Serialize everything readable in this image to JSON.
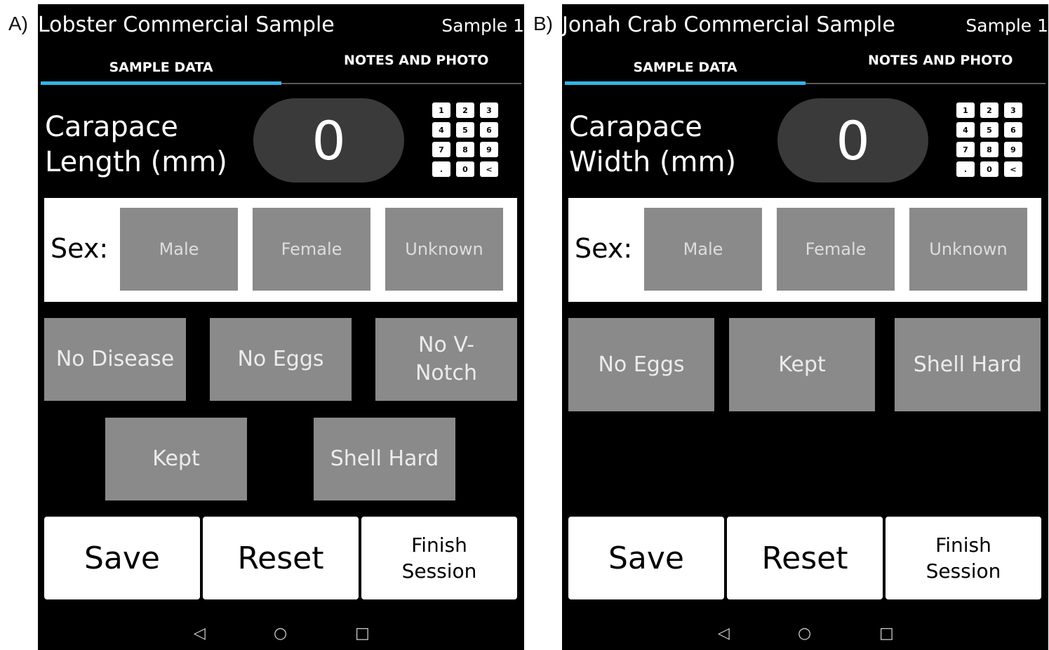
{
  "panels": [
    {
      "label": "A)",
      "title": "Lobster Commercial Sample",
      "sample": "Sample 1",
      "tabs": [
        "SAMPLE DATA",
        "NOTES AND PHOTO"
      ],
      "measure_label": "Carapace Length (mm)",
      "value": "0",
      "keypad": [
        "1",
        "2",
        "3",
        "4",
        "5",
        "6",
        "7",
        "8",
        "9",
        ".",
        "0",
        "<"
      ],
      "sex_label": "Sex:",
      "sex_options": [
        "Male",
        "Female",
        "Unknown"
      ],
      "toggles": [
        "No Disease",
        "No Eggs",
        "No V-Notch",
        "Kept",
        "Shell Hard"
      ],
      "actions": [
        "Save",
        "Reset",
        "Finish Session"
      ],
      "nav": [
        "◁",
        "○",
        "□"
      ]
    },
    {
      "label": "B)",
      "title": "Jonah Crab Commercial Sample",
      "sample": "Sample 1",
      "tabs": [
        "SAMPLE DATA",
        "NOTES AND PHOTO"
      ],
      "measure_label": "Carapace Width (mm)",
      "value": "0",
      "keypad": [
        "1",
        "2",
        "3",
        "4",
        "5",
        "6",
        "7",
        "8",
        "9",
        ".",
        "0",
        "<"
      ],
      "sex_label": "Sex:",
      "sex_options": [
        "Male",
        "Female",
        "Unknown"
      ],
      "toggles": [
        "No Eggs",
        "Kept",
        "Shell Hard"
      ],
      "actions": [
        "Save",
        "Reset",
        "Finish Session"
      ],
      "nav": [
        "◁",
        "○",
        "□"
      ]
    }
  ],
  "colors": {
    "tab_indicator": "#33b5e5",
    "toggle_bg": "#8a8a8a",
    "value_pill_bg": "#3a3a3a",
    "screen_bg": "#000000"
  }
}
